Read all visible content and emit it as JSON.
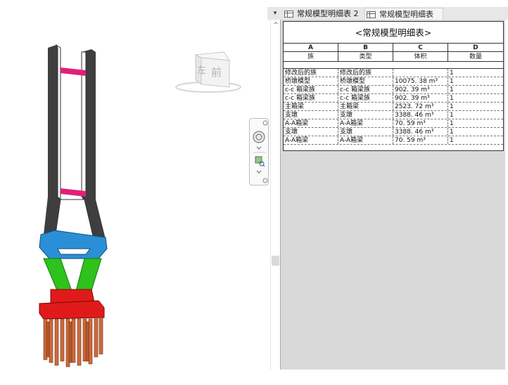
{
  "tabs": [
    {
      "label": "常规模型明细表 2",
      "icon": "schedule-icon"
    },
    {
      "label": "常规模型明细表",
      "icon": "schedule-icon"
    }
  ],
  "tab_menu_icon": "dropdown-icon",
  "viewcube": {
    "left_label": "左",
    "front_label": "前"
  },
  "navigation_bar": {
    "icons": [
      "close-icon",
      "steering-wheel-icon",
      "chevron-down-icon",
      "zoom-region-icon",
      "chevron-down-icon",
      "resize-icon"
    ]
  },
  "schedule": {
    "title": "<常规模型明细表>",
    "column_letters": [
      "A",
      "B",
      "C",
      "D"
    ],
    "column_headers": [
      "族",
      "类型",
      "体积",
      "数量"
    ],
    "rows": [
      [
        "修改后的族",
        "修改后的族",
        "",
        "1"
      ],
      [
        "桥墩模型",
        "桥墩模型",
        "10075. 38 m³",
        "1"
      ],
      [
        "c-c 箱梁族",
        "c-c 箱梁族",
        "902. 39 m³",
        "1"
      ],
      [
        "c-c 箱梁族",
        "c-c 箱梁族",
        "902. 39 m³",
        "1"
      ],
      [
        "主箱梁",
        "主箱梁",
        "2523. 72 m³",
        "1"
      ],
      [
        "支墩",
        "支墩",
        "3388. 46 m³",
        "1"
      ],
      [
        "A-A箱梁",
        "A-A箱梁",
        "70. 59 m³",
        "1"
      ],
      [
        "支墩",
        "支墩",
        "3388. 46 m³",
        "1"
      ],
      [
        "A-A箱梁",
        "A-A箱梁",
        "70. 59 m³",
        "1"
      ]
    ]
  },
  "colors": {
    "tower": "#4a4a4a",
    "crossbeam": "#e0207a",
    "cap_beam": "#2a8fd6",
    "lower_legs": "#2ec21c",
    "pile_cap": "#e01a1a",
    "piles": "#cf6a3c"
  }
}
